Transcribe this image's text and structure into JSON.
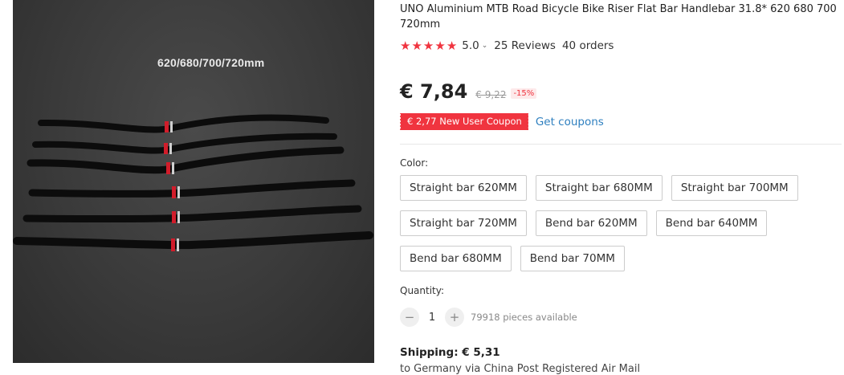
{
  "image": {
    "caption": "620/680/700/720mm"
  },
  "product": {
    "title": "UNO Aluminium MTB Road Bicycle Bike Riser Flat Bar Handlebar 31.8* 620 680 700 720mm",
    "rating": {
      "stars": 5,
      "score": "5.0",
      "reviews": "25 Reviews",
      "orders": "40 orders"
    },
    "price": {
      "current": "€ 7,84",
      "original": "€ 9,22",
      "discount": "-15%"
    },
    "coupon": {
      "badge": "€ 2,77 New User Coupon",
      "link": "Get coupons"
    },
    "color": {
      "label": "Color:",
      "options": [
        "Straight bar 620MM",
        "Straight bar 680MM",
        "Straight bar 700MM",
        "Straight bar 720MM",
        "Bend bar 620MM",
        "Bend bar 640MM",
        "Bend bar 680MM",
        "Bend bar 70MM"
      ]
    },
    "quantity": {
      "label": "Quantity:",
      "value": "1",
      "available": "79918 pieces available"
    },
    "shipping": {
      "label": "Shipping: € 5,31",
      "detail": "to Germany via China Post Registered Air Mail"
    }
  },
  "colors": {
    "accent": "#f0343f",
    "link": "#2e7fbf"
  }
}
